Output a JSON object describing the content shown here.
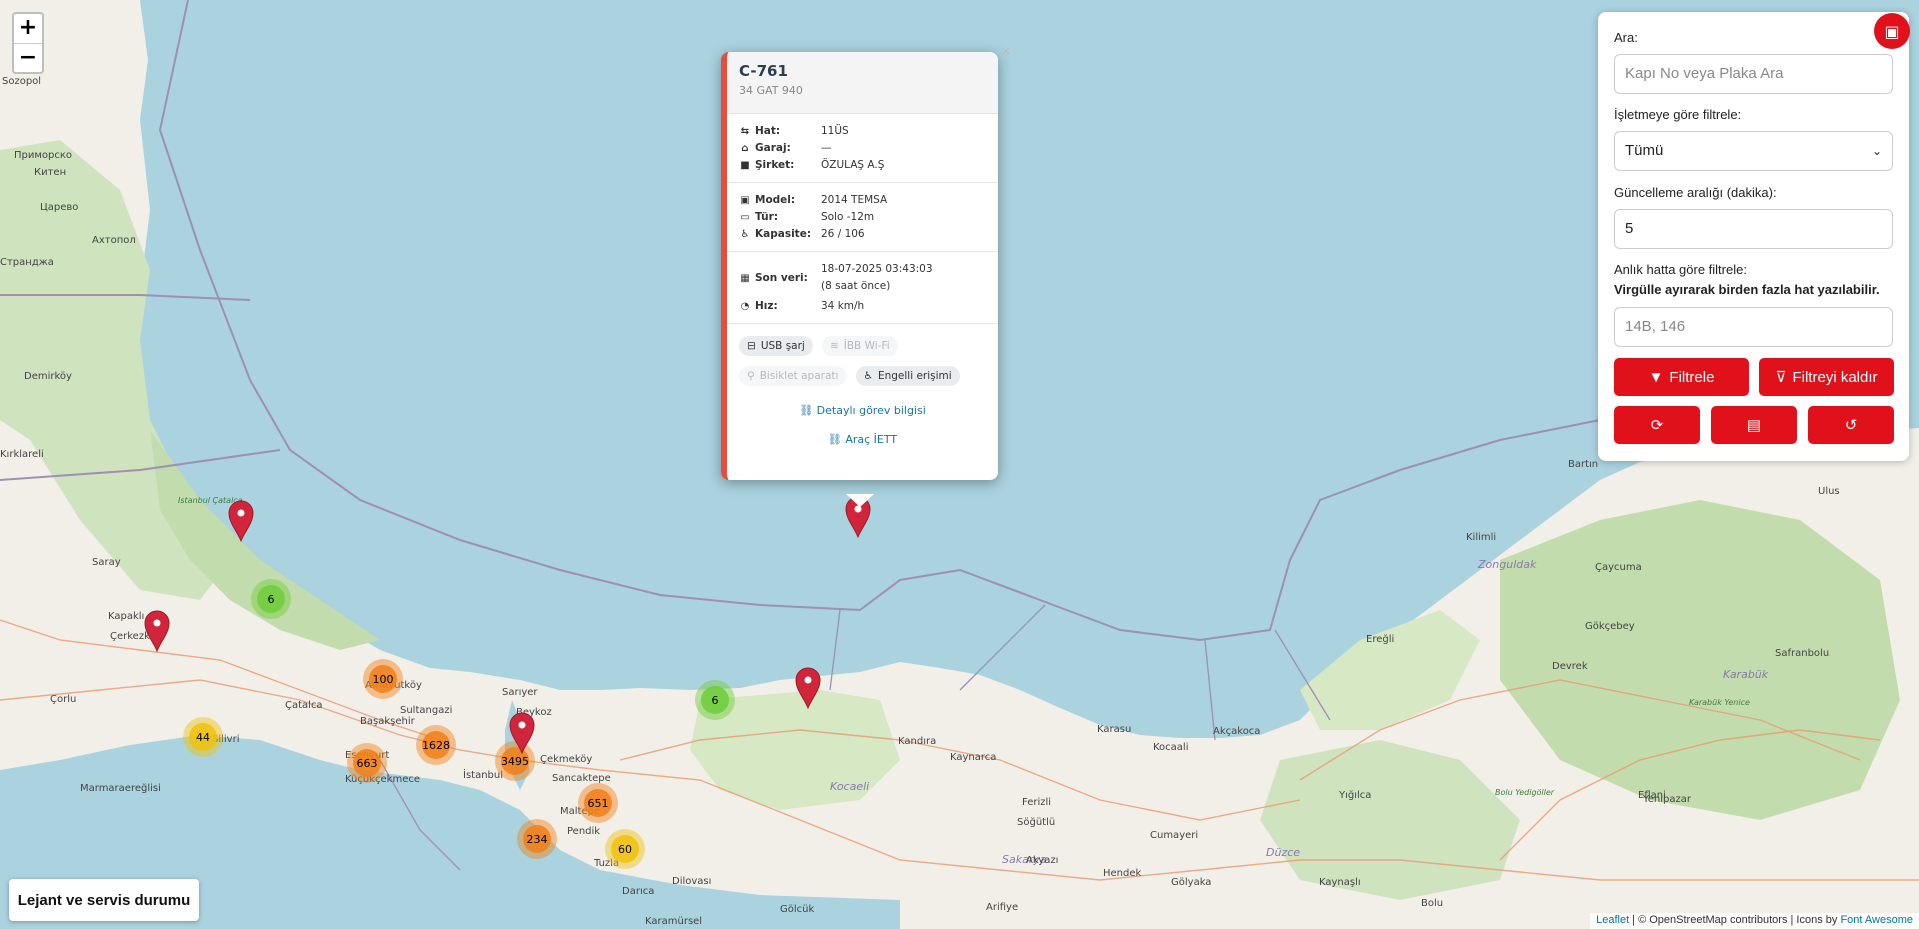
{
  "map": {
    "zoom_in": "+",
    "zoom_out": "−",
    "place_labels": [
      "Sozopol",
      "Приморско",
      "Китен",
      "Царево",
      "Ахтопол",
      "Странджа",
      "Demirköy",
      "Kırklareli",
      "Istanbul Çatalca Çilingoz Yaban Hayatı Geliştirme Sahası",
      "Saray",
      "Kapaklı",
      "Çerkezköy",
      "Çorlu",
      "Silivri",
      "Marmaraereğlisi",
      "Çatalca",
      "Arnavutköy",
      "Başakşehir",
      "Esenyurt",
      "Küçükçekmece",
      "Sultangazi",
      "Sarıyer",
      "Beykoz",
      "İstanbul",
      "Çekmeköy",
      "Sancaktepe",
      "Maltepe",
      "Pendik",
      "Tuzla",
      "Dilovası",
      "Darıca",
      "Gölcük",
      "Kocaeli",
      "Kandıra",
      "Kaynarca",
      "Karasu",
      "Kocaali",
      "Akçakoca",
      "Ferizli",
      "Söğütlü",
      "Sakarya",
      "Hendek",
      "Cumayeri",
      "Düzce",
      "Gölyaka",
      "Kaynaşlı",
      "Yığılca",
      "Bolu Yedigöller Yaban Hayatı Geliştirme Sahası",
      "Bolu",
      "Bartın",
      "Ulus",
      "Kilimli",
      "Zonguldak",
      "Çaycuma",
      "Gökçebey",
      "Ereğli",
      "Devrek",
      "Safranbolu",
      "Karabük",
      "Karabük Yenice Yaban Hayatı Geliştirme Sahası",
      "Eflani",
      "Yenipazar",
      "Arifiye",
      "Karamürsel",
      "Akyazı"
    ],
    "clusters": [
      {
        "label": "6",
        "level": "small"
      },
      {
        "label": "100",
        "level": "large"
      },
      {
        "label": "44",
        "level": "medium"
      },
      {
        "label": "663",
        "level": "large"
      },
      {
        "label": "1628",
        "level": "large"
      },
      {
        "label": "3495",
        "level": "large"
      },
      {
        "label": "651",
        "level": "large"
      },
      {
        "label": "234",
        "level": "large"
      },
      {
        "label": "60",
        "level": "medium"
      },
      {
        "label": "6",
        "level": "small"
      }
    ],
    "colors": {
      "sea": "#aad3df",
      "land": "#f2efe9",
      "forest": "#b5d29f",
      "border": "#9e8fb3",
      "cluster_small": "#6ecc39",
      "cluster_medium": "#f0c20c",
      "cluster_large": "#f18017",
      "marker": "#d1253b",
      "accent": "#e0111a"
    }
  },
  "popup": {
    "title": "C-761",
    "plate": "34 GAT 940",
    "route": {
      "hat_label": "Hat:",
      "hat_value": "11ÜS",
      "garaj_label": "Garaj:",
      "garaj_value": "—",
      "sirket_label": "Şirket:",
      "sirket_value": "ÖZULAŞ A.Ş"
    },
    "vehicle": {
      "model_label": "Model:",
      "model_value": "2014 TEMSA",
      "tur_label": "Tür:",
      "tur_value": "Solo -12m",
      "kapasite_label": "Kapasite:",
      "kapasite_value": "26 / 106"
    },
    "status": {
      "son_label": "Son veri:",
      "son_value": "18-07-2025 03:43:03",
      "son_ago": "(8 saat önce)",
      "hiz_label": "Hız:",
      "hiz_value": "34 km/h"
    },
    "features": [
      {
        "label": "USB şarj",
        "active": true,
        "icon": "usb-icon"
      },
      {
        "label": "İBB Wi-Fi",
        "active": false,
        "icon": "wifi-icon"
      },
      {
        "label": "Bisiklet aparatı",
        "active": false,
        "icon": "bicycle-icon"
      },
      {
        "label": "Engelli erişimi",
        "active": true,
        "icon": "wheelchair-icon"
      }
    ],
    "link_detail": "Detaylı görev bilgisi",
    "link_iett": "Araç İETT",
    "close": "×"
  },
  "panel": {
    "search_label": "Ara:",
    "search_placeholder": "Kapı No veya Plaka Ara",
    "operator_label": "İşletmeye göre filtrele:",
    "operator_value": "Tümü",
    "interval_label": "Güncelleme aralığı (dakika):",
    "interval_value": "5",
    "line_label": "Anlık hatta göre filtrele:",
    "line_hint": "Virgülle ayırarak birden fazla hat yazılabilir.",
    "line_placeholder": "14B, 146",
    "filter_button": "Filtrele",
    "clear_button": "Filtreyi kaldır"
  },
  "legend": {
    "label": "Lejant ve servis durumu"
  },
  "attribution": {
    "leaflet": "Leaflet",
    "sep1": " | © OpenStreetMap contributors | Icons by ",
    "fa": "Font Awesome"
  }
}
